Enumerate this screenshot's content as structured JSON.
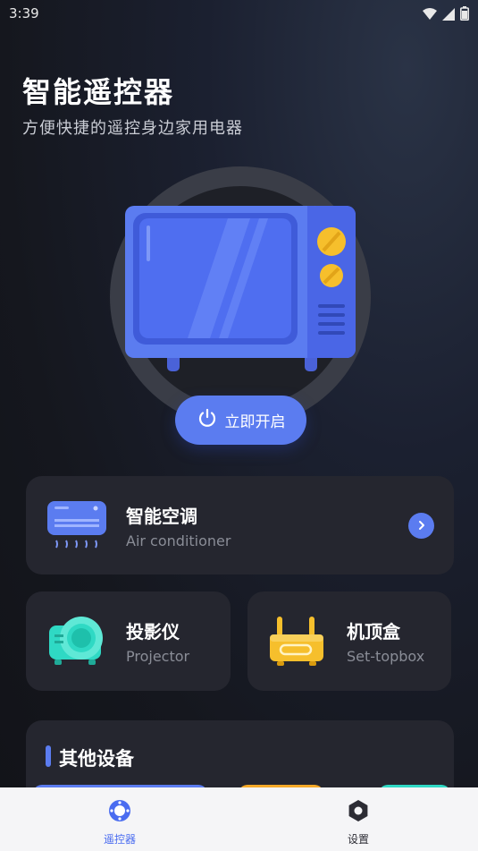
{
  "status": {
    "time": "3:39"
  },
  "header": {
    "title": "智能遥控器",
    "subtitle": "方便快捷的遥控身边家用电器"
  },
  "hero": {
    "power_label": "立即开启"
  },
  "devices": [
    {
      "title": "智能空调",
      "subtitle": "Air conditioner"
    },
    {
      "title": "投影仪",
      "subtitle": "Projector"
    },
    {
      "title": "机顶盒",
      "subtitle": "Set-topbox"
    }
  ],
  "other": {
    "title": "其他设备"
  },
  "tabs": [
    {
      "label": "遥控器",
      "active": true
    },
    {
      "label": "设置",
      "active": false
    }
  ],
  "colors": {
    "accent": "#5b7cf0",
    "card": "#25262f",
    "tab_active": "#4a6cf0",
    "tab_inactive": "#2c2c34"
  },
  "icons": [
    "wifi-icon",
    "signal-icon",
    "battery-icon",
    "tv-icon",
    "power-icon",
    "air-conditioner-icon",
    "chevron-right-icon",
    "projector-icon",
    "router-icon",
    "remote-tab-icon",
    "settings-tab-icon"
  ]
}
